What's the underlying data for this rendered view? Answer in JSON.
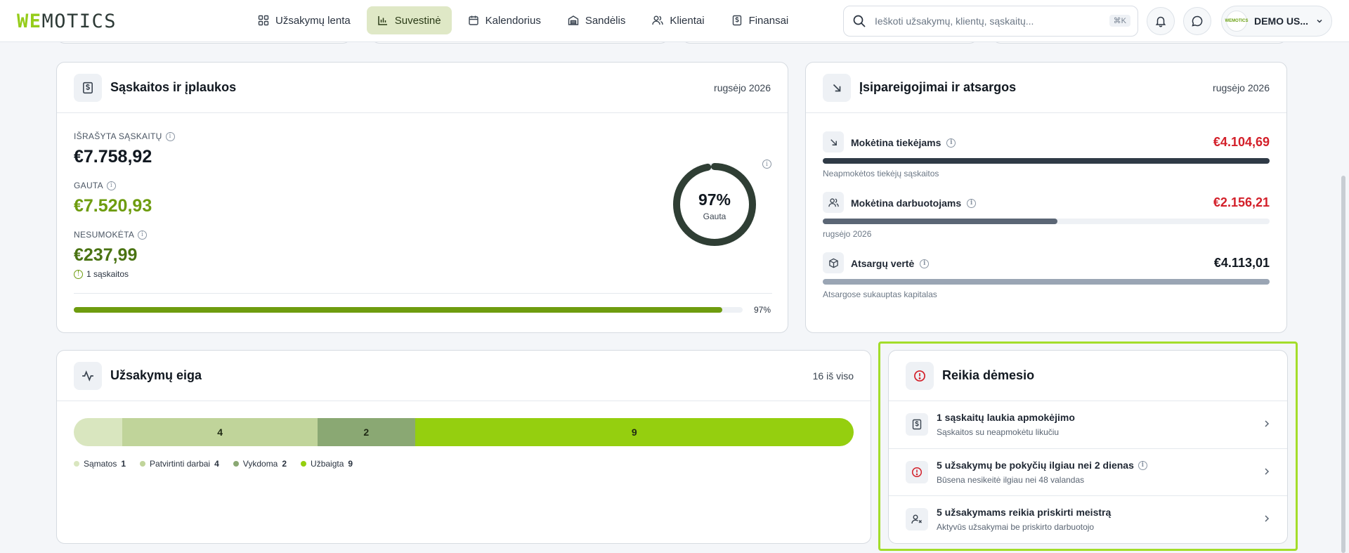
{
  "header": {
    "logo_we": "WE",
    "logo_rest": "MOTICS",
    "nav": [
      {
        "label": "Užsakymų lenta",
        "icon": "grid-icon",
        "active": false
      },
      {
        "label": "Suvestinė",
        "icon": "bar-chart-icon",
        "active": true
      },
      {
        "label": "Kalendorius",
        "icon": "calendar-icon",
        "active": false
      },
      {
        "label": "Sandėlis",
        "icon": "warehouse-icon",
        "active": false
      },
      {
        "label": "Klientai",
        "icon": "users-icon",
        "active": false
      },
      {
        "label": "Finansai",
        "icon": "receipt-icon",
        "active": false
      }
    ],
    "search_placeholder": "Ieškoti užsakymų, klientų, sąskaitų...",
    "search_shortcut": "⌘K",
    "user_name": "DEMO US...",
    "avatar_text": "WEMOTICS"
  },
  "invoices": {
    "title": "Sąskaitos ir įplaukos",
    "period": "rugsėjo 2026",
    "issued_label": "IŠRAŠYTA SĄSKAITŲ",
    "issued_value": "€7.758,92",
    "received_label": "GAUTA",
    "received_value": "€7.520,93",
    "unpaid_label": "NESUMOKĖTA",
    "unpaid_value": "€237,99",
    "unpaid_note": "1 sąskaitos",
    "donut_pct": "97%",
    "donut_label": "Gauta",
    "donut_fraction": 0.97,
    "bar_pct_label": "97%",
    "bar_fraction": 0.97
  },
  "commitments": {
    "title": "Įsipareigojimai ir atsargos",
    "period": "rugsėjo 2026",
    "rows": [
      {
        "label": "Mokėtina tiekėjams",
        "value": "€4.104,69",
        "sub": "Neapmokėtos tiekėjų sąskaitos",
        "fraction": 1.0,
        "color": "#2f3a46",
        "value_color": "#d3202a"
      },
      {
        "label": "Mokėtina darbuotojams",
        "value": "€2.156,21",
        "sub": "rugsėjo 2026",
        "fraction": 0.525,
        "color": "#5b6675",
        "value_color": "#d3202a"
      },
      {
        "label": "Atsargų vertė",
        "value": "€4.113,01",
        "sub": "Atsargose sukauptas kapitalas",
        "fraction": 1.0,
        "color": "#9aa5b4",
        "value_color": "#111820"
      }
    ]
  },
  "orders": {
    "title": "Užsakymų eiga",
    "meta": "16 iš viso",
    "segments": [
      {
        "name": "Sąmatos",
        "count": 1,
        "color": "#d9e6bf",
        "label": ""
      },
      {
        "name": "Patvirtinti darbai",
        "count": 4,
        "color": "#c0d49a",
        "label": "4"
      },
      {
        "name": "Vykdoma",
        "count": 2,
        "color": "#8aa873",
        "label": "2"
      },
      {
        "name": "Užbaigta",
        "count": 9,
        "color": "#95cf0f",
        "label": "9"
      }
    ],
    "legend_counts": [
      "1",
      "4",
      "2",
      "9"
    ]
  },
  "attention": {
    "title": "Reikia dėmesio",
    "items": [
      {
        "title": "1 sąskaitų laukia apmokėjimo",
        "sub": "Sąskaitos su neapmokėtu likučiu",
        "icon": "receipt-icon"
      },
      {
        "title": "5 užsakymų be pokyčių ilgiau nei 2 dienas",
        "sub": "Būsena nesikeitė ilgiau nei 48 valandas",
        "icon": "alert-circle-icon"
      },
      {
        "title": "5 užsakymams reikia priskirti meistrą",
        "sub": "Aktyvūs užsakymai be priskirto darbuotojo",
        "icon": "user-x-icon"
      }
    ]
  },
  "colors": {
    "accent_green": "#95cc1a",
    "received_green": "#6e9c0f",
    "unpaid_green": "#4a7312",
    "danger_red": "#d3202a",
    "donut_dark": "#2f3e34"
  }
}
